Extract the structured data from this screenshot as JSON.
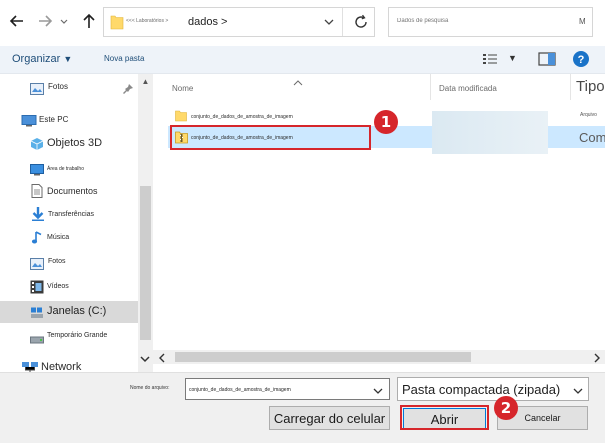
{
  "address_bar": {
    "parent_segment": "<<< Laboratórios >",
    "current_folder": "dados >"
  },
  "search": {
    "placeholder": "Dados de pesquisa",
    "trailing_text": "M"
  },
  "toolbar": {
    "organize_label": "Organizar",
    "new_folder_label": "Nova pasta"
  },
  "sidebar": {
    "items": [
      {
        "label": "Fotos",
        "icon": "pictures-icon",
        "pinned": true
      },
      {
        "label": "Este PC",
        "icon": "this-pc-icon"
      },
      {
        "label": "Objetos 3D",
        "icon": "3d-objects-icon"
      },
      {
        "label": "Área de trabalho",
        "icon": "desktop-icon"
      },
      {
        "label": "Documentos",
        "icon": "documents-icon"
      },
      {
        "label": "Transferências",
        "icon": "downloads-icon"
      },
      {
        "label": "Música",
        "icon": "music-icon"
      },
      {
        "label": "Fotos",
        "icon": "pictures-icon"
      },
      {
        "label": "Vídeos",
        "icon": "videos-icon"
      },
      {
        "label": "Janelas (C:)",
        "icon": "drive-icon"
      },
      {
        "label": "Temporário Grande",
        "icon": "drive-icon"
      },
      {
        "label": "Network",
        "icon": "network-icon"
      }
    ]
  },
  "columns": {
    "name": "Nome",
    "date_modified": "Data modificada",
    "type": "Tipo"
  },
  "files": [
    {
      "name": "conjunto_de_dados_de_amostra_de_imagem",
      "type": "Arquivo",
      "icon": "folder-icon",
      "selected": false
    },
    {
      "name": "conjunto_de_dados_de_amostra_de_imagem",
      "type": "Com",
      "icon": "zip-folder-icon",
      "selected": true
    }
  ],
  "bottom": {
    "filename_label": "Nome do arquivo:",
    "filename_value": "conjunto_de_dados_de_amostra_de_imagem",
    "filetype_value": "Pasta compactada (zipada)",
    "upload_label": "Carregar do celular",
    "open_label": "Abrir",
    "cancel_label": "Cancelar"
  },
  "annotations": {
    "step1": "1",
    "step2": "2"
  },
  "colors": {
    "accent": "#1a73c8",
    "annotation_red": "#d6262b",
    "selection": "#cce8ff",
    "folder_yellow": "#ffd96a"
  }
}
